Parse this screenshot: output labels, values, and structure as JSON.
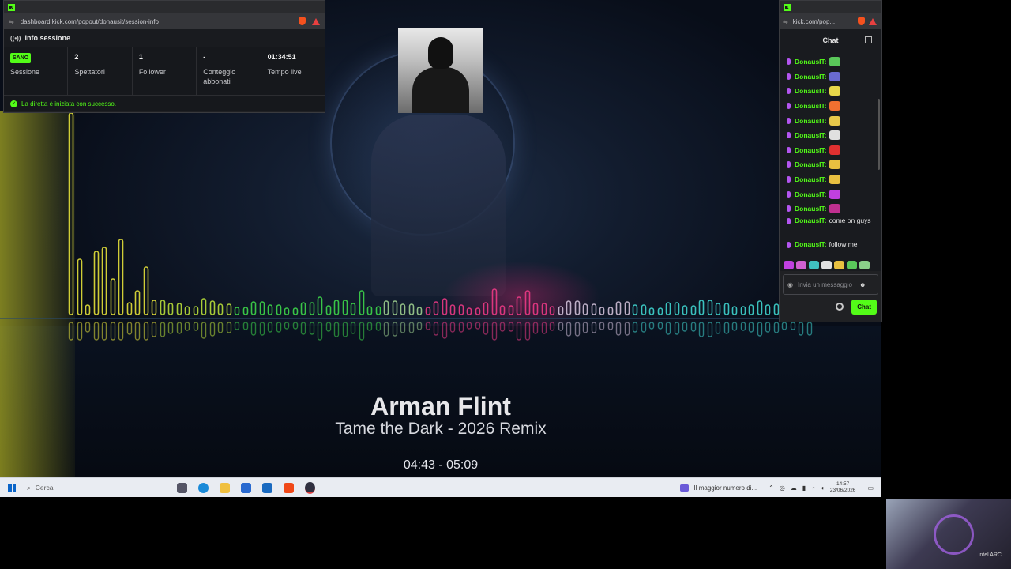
{
  "session_window": {
    "url": "dashboard.kick.com/popout/donausit/session-info",
    "panel_title": "Info sessione",
    "stats": [
      {
        "value": "SANO",
        "label": "Sessione",
        "is_badge": true
      },
      {
        "value": "2",
        "label": "Spettatori"
      },
      {
        "value": "1",
        "label": "Follower"
      },
      {
        "value": "-",
        "label": "Conteggio abbonati"
      },
      {
        "value": "01:34:51",
        "label": "Tempo live"
      }
    ],
    "success_message": "La diretta è iniziata con successo."
  },
  "chat_window": {
    "url": "kick.com/pop...",
    "title": "Chat",
    "messages": [
      {
        "user": "DonausIT:",
        "emote_color": "#5ac85a"
      },
      {
        "user": "DonausIT:",
        "emote_color": "#6a6ad0"
      },
      {
        "user": "DonausIT:",
        "emote_color": "#e8d84a"
      },
      {
        "user": "DonausIT:",
        "emote_color": "#f07030"
      },
      {
        "user": "DonausIT:",
        "emote_color": "#e8c84a"
      },
      {
        "user": "DonausIT:",
        "emote_color": "#e0e0e0"
      },
      {
        "user": "DonausIT:",
        "emote_color": "#e03030"
      },
      {
        "user": "DonausIT:",
        "emote_color": "#e8c040"
      },
      {
        "user": "DonausIT:",
        "emote_color": "#e8c040"
      },
      {
        "user": "DonausIT:",
        "emote_color": "#c040e0"
      },
      {
        "user": "DonausIT:",
        "emote_color": "#c03090"
      }
    ],
    "text_messages": [
      {
        "user": "DonausIT:",
        "text": "come on guys"
      },
      {
        "user": "DonausIT:",
        "text": "follow me"
      }
    ],
    "emote_bar": [
      "#c040e0",
      "#d060d0",
      "#40c0c0",
      "#e0e0e0",
      "#e8c040",
      "#5ac85a",
      "#8ad08a"
    ],
    "input_placeholder": "Invia un messaggio",
    "send_label": "Chat"
  },
  "now_playing": {
    "artist": "Arman Flint",
    "title": "Tame the Dark - 2026 Remix",
    "time": "04:43 - 05:09"
  },
  "taskbar": {
    "search_label": "Cerca",
    "notification": "Il maggior numero di...",
    "time": "14:57",
    "date": "23/06/2026"
  },
  "webcam": {
    "brand": "intel ARC"
  }
}
